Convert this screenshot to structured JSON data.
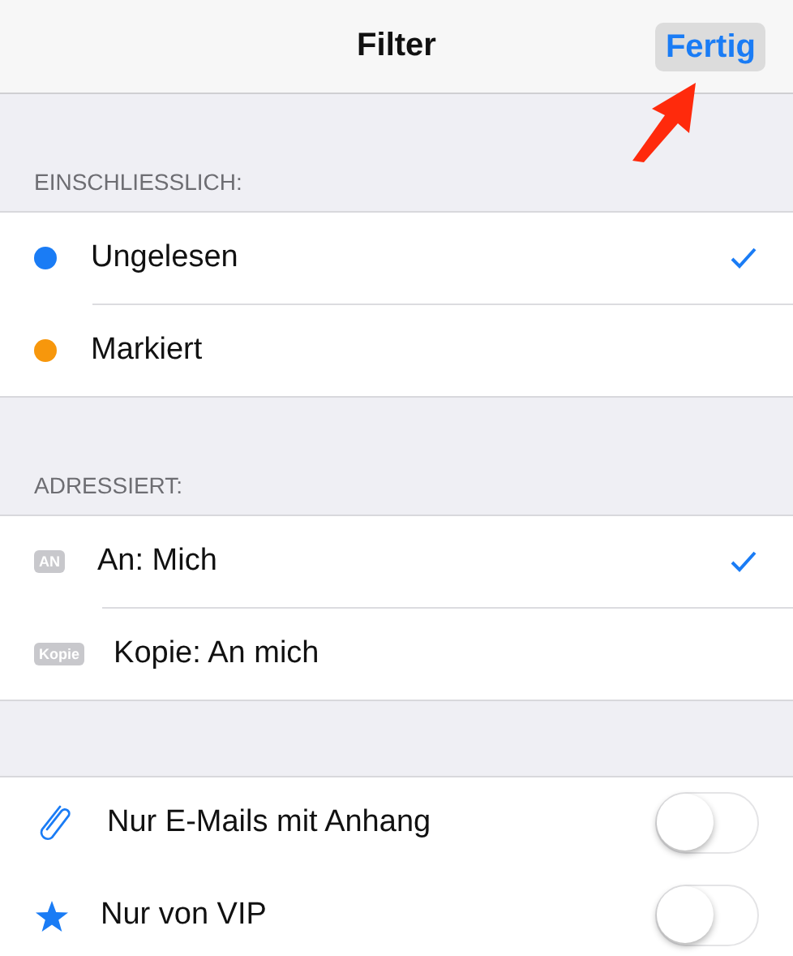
{
  "nav": {
    "title": "Filter",
    "done": "Fertig"
  },
  "sections": [
    {
      "header": "EINSCHLIESSLICH:",
      "rows": [
        {
          "kind": "dot",
          "color": "#1a7cf5",
          "label": "Ungelesen",
          "checked": true
        },
        {
          "kind": "dot",
          "color": "#f7970c",
          "label": "Markiert",
          "checked": false
        }
      ]
    },
    {
      "header": "ADRESSIERT:",
      "rows": [
        {
          "kind": "badge",
          "badge": "AN",
          "label": "An: Mich",
          "checked": true
        },
        {
          "kind": "badge",
          "badge": "Kopie",
          "label": "Kopie: An mich",
          "checked": false
        }
      ]
    },
    {
      "rows": [
        {
          "kind": "clip",
          "label": "Nur E-Mails mit Anhang",
          "on": false
        },
        {
          "kind": "star",
          "label": "Nur von VIP",
          "on": false
        }
      ]
    }
  ]
}
